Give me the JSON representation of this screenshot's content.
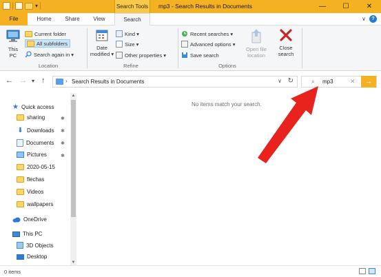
{
  "title_bar": {
    "context_tab": "Search Tools",
    "window_title": "mp3 - Search Results in Documents",
    "minimize": "—",
    "maximize": "☐",
    "close": "✕",
    "quick_access_dropdown": "▾"
  },
  "tabs": {
    "file": "File",
    "home": "Home",
    "share": "Share",
    "view": "View",
    "search": "Search",
    "expand_glyph": "∨",
    "help_glyph": "?"
  },
  "ribbon": {
    "location": {
      "this_pc": "This PC",
      "current_folder": "Current folder",
      "all_subfolders": "All subfolders",
      "search_again_in": "Search again in ▾",
      "group_label": "Location"
    },
    "refine": {
      "date_modified": "Date modified ▾",
      "kind": "Kind ▾",
      "size": "Size ▾",
      "other_properties": "Other properties ▾",
      "group_label": "Refine"
    },
    "options": {
      "recent_searches": "Recent searches ▾",
      "advanced_options": "Advanced options ▾",
      "save_search": "Save search",
      "open_file_location": "Open file location",
      "close_search": "Close search",
      "group_label": "Options"
    }
  },
  "nav": {
    "back": "←",
    "forward": "→",
    "recent": "▾",
    "up": "↑"
  },
  "address": {
    "chevron": "›",
    "path": "Search Results in Documents",
    "dropdown": "∨",
    "refresh": "↻"
  },
  "search": {
    "icon": "⌕",
    "value": "mp3",
    "clear": "✕",
    "go": "→"
  },
  "sidebar": {
    "quick_access": "Quick access",
    "items": [
      {
        "label": "sharing",
        "pinned": true
      },
      {
        "label": "Downloads",
        "pinned": true
      },
      {
        "label": "Documents",
        "pinned": true
      },
      {
        "label": "Pictures",
        "pinned": true
      },
      {
        "label": "2020-05-15",
        "pinned": false
      },
      {
        "label": "flechas",
        "pinned": false
      },
      {
        "label": "Videos",
        "pinned": false
      },
      {
        "label": "wallpapers",
        "pinned": false
      }
    ],
    "pin_glyph": "✱",
    "onedrive": "OneDrive",
    "this_pc": "This PC",
    "objects_3d": "3D Objects",
    "desktop": "Desktop",
    "scroll_up": "▲",
    "scroll_down": "▼"
  },
  "content": {
    "empty_message": "No items match your search."
  },
  "status": {
    "item_count": "0 items"
  },
  "colors": {
    "accent": "#f4b223",
    "annotation_arrow": "#e8231d",
    "selection": "#cce4f7"
  }
}
